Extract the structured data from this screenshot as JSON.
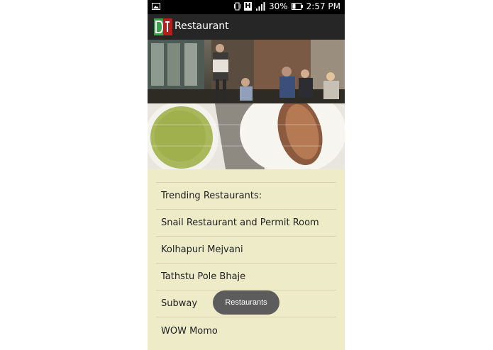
{
  "status_bar": {
    "network": "H",
    "battery": "30%",
    "time": "2:57 PM"
  },
  "icons": {
    "gallery": "image-icon",
    "vibrate": "vibrate-icon",
    "signal": "signal-icon",
    "battery": "battery-icon",
    "app_logo": "app-logo-icon"
  },
  "app_bar": {
    "title": "Restaurant"
  },
  "restaurants": [
    "Trending Restaurants:",
    "Snail Restaurant and Permit Room",
    "Kolhapuri Mejvani",
    "Tathstu Pole Bhaje",
    "Subway",
    "WOW Momo"
  ],
  "toast": {
    "text": "Restaurants"
  },
  "colors": {
    "background": "#eeebc9",
    "action_bar": "#262626",
    "toast": "#5c5c5c"
  }
}
